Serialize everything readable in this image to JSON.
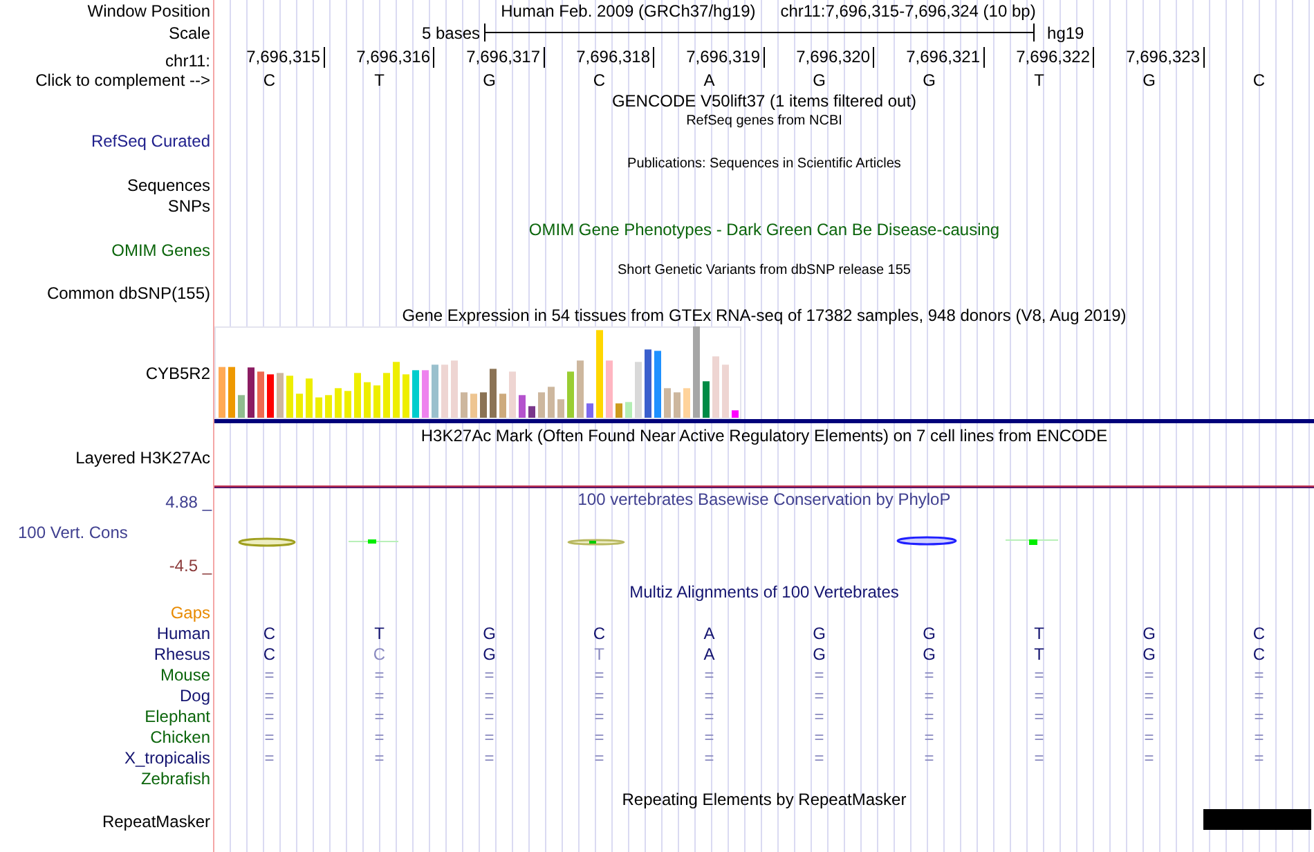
{
  "header": {
    "label": "Window Position",
    "assembly": "Human Feb. 2009 (GRCh37/hg19)",
    "position": "chr11:7,696,315-7,696,324 (10 bp)"
  },
  "scale": {
    "label": "Scale",
    "span": "5 bases",
    "genome": "hg19"
  },
  "ruler": {
    "label": "chr11:",
    "ticks": [
      "7,696,315",
      "7,696,316",
      "7,696,317",
      "7,696,318",
      "7,696,319",
      "7,696,320",
      "7,696,321",
      "7,696,322",
      "7,696,323"
    ]
  },
  "sequence": {
    "label": "Click to complement -->",
    "bases": [
      "C",
      "T",
      "G",
      "C",
      "A",
      "G",
      "G",
      "T",
      "G",
      "C"
    ]
  },
  "gencode": {
    "title": "GENCODE V50lift37 (1 items filtered out)"
  },
  "refseq": {
    "title": "RefSeq genes from NCBI",
    "label": "RefSeq Curated"
  },
  "publications": {
    "title": "Publications: Sequences in Scientific Articles",
    "label": "Sequences"
  },
  "snps": {
    "label": "SNPs"
  },
  "omim": {
    "title": "OMIM Gene Phenotypes - Dark Green Can Be Disease-causing",
    "label": "OMIM Genes"
  },
  "dbsnp": {
    "title": "Short Genetic Variants from dbSNP release 155",
    "label": "Common dbSNP(155)"
  },
  "gtex": {
    "title": "Gene Expression in 54 tissues from GTEx RNA-seq of 17382 samples, 948 donors (V8, Aug 2019)",
    "label": "CYB5R2"
  },
  "h3k27ac": {
    "title": "H3K27Ac Mark (Often Found Near Active Regulatory Elements) on 7 cell lines from ENCODE",
    "label": "Layered H3K27Ac"
  },
  "conservation": {
    "title": "100 vertebrates Basewise Conservation by PhyloP",
    "label": "100 Vert. Cons",
    "max": "4.88 _",
    "min": "-4.5 _"
  },
  "multiz": {
    "title": "Multiz Alignments of 100 Vertebrates",
    "gaps_label": "Gaps",
    "species": [
      {
        "name": "Human",
        "color": "#141470",
        "bases": [
          "C",
          "T",
          "G",
          "C",
          "A",
          "G",
          "G",
          "T",
          "G",
          "C"
        ],
        "faded": [
          false,
          false,
          false,
          false,
          false,
          false,
          false,
          false,
          false,
          false
        ]
      },
      {
        "name": "Rhesus",
        "color": "#141470",
        "bases": [
          "C",
          "C",
          "G",
          "T",
          "A",
          "G",
          "G",
          "T",
          "G",
          "C"
        ],
        "faded": [
          false,
          true,
          false,
          true,
          false,
          false,
          false,
          false,
          false,
          false
        ]
      },
      {
        "name": "Mouse",
        "color": "#0b650b",
        "bases": [
          "=",
          "=",
          "=",
          "=",
          "=",
          "=",
          "=",
          "=",
          "=",
          "="
        ],
        "faded": [
          true,
          true,
          true,
          true,
          true,
          true,
          true,
          true,
          true,
          true
        ]
      },
      {
        "name": "Dog",
        "color": "#141470",
        "bases": [
          "=",
          "=",
          "=",
          "=",
          "=",
          "=",
          "=",
          "=",
          "=",
          "="
        ],
        "faded": [
          true,
          true,
          true,
          true,
          true,
          true,
          true,
          true,
          true,
          true
        ]
      },
      {
        "name": "Elephant",
        "color": "#0b650b",
        "bases": [
          "=",
          "=",
          "=",
          "=",
          "=",
          "=",
          "=",
          "=",
          "=",
          "="
        ],
        "faded": [
          true,
          true,
          true,
          true,
          true,
          true,
          true,
          true,
          true,
          true
        ]
      },
      {
        "name": "Chicken",
        "color": "#0b650b",
        "bases": [
          "=",
          "=",
          "=",
          "=",
          "=",
          "=",
          "=",
          "=",
          "=",
          "="
        ],
        "faded": [
          true,
          true,
          true,
          true,
          true,
          true,
          true,
          true,
          true,
          true
        ]
      },
      {
        "name": "X_tropicalis",
        "color": "#141470",
        "bases": [
          "=",
          "=",
          "=",
          "=",
          "=",
          "=",
          "=",
          "=",
          "=",
          "="
        ],
        "faded": [
          true,
          true,
          true,
          true,
          true,
          true,
          true,
          true,
          true,
          true
        ]
      },
      {
        "name": "Zebrafish",
        "color": "#0b650b"
      }
    ]
  },
  "repeatmasker": {
    "title": "Repeating Elements by RepeatMasker",
    "label": "RepeatMasker"
  }
}
